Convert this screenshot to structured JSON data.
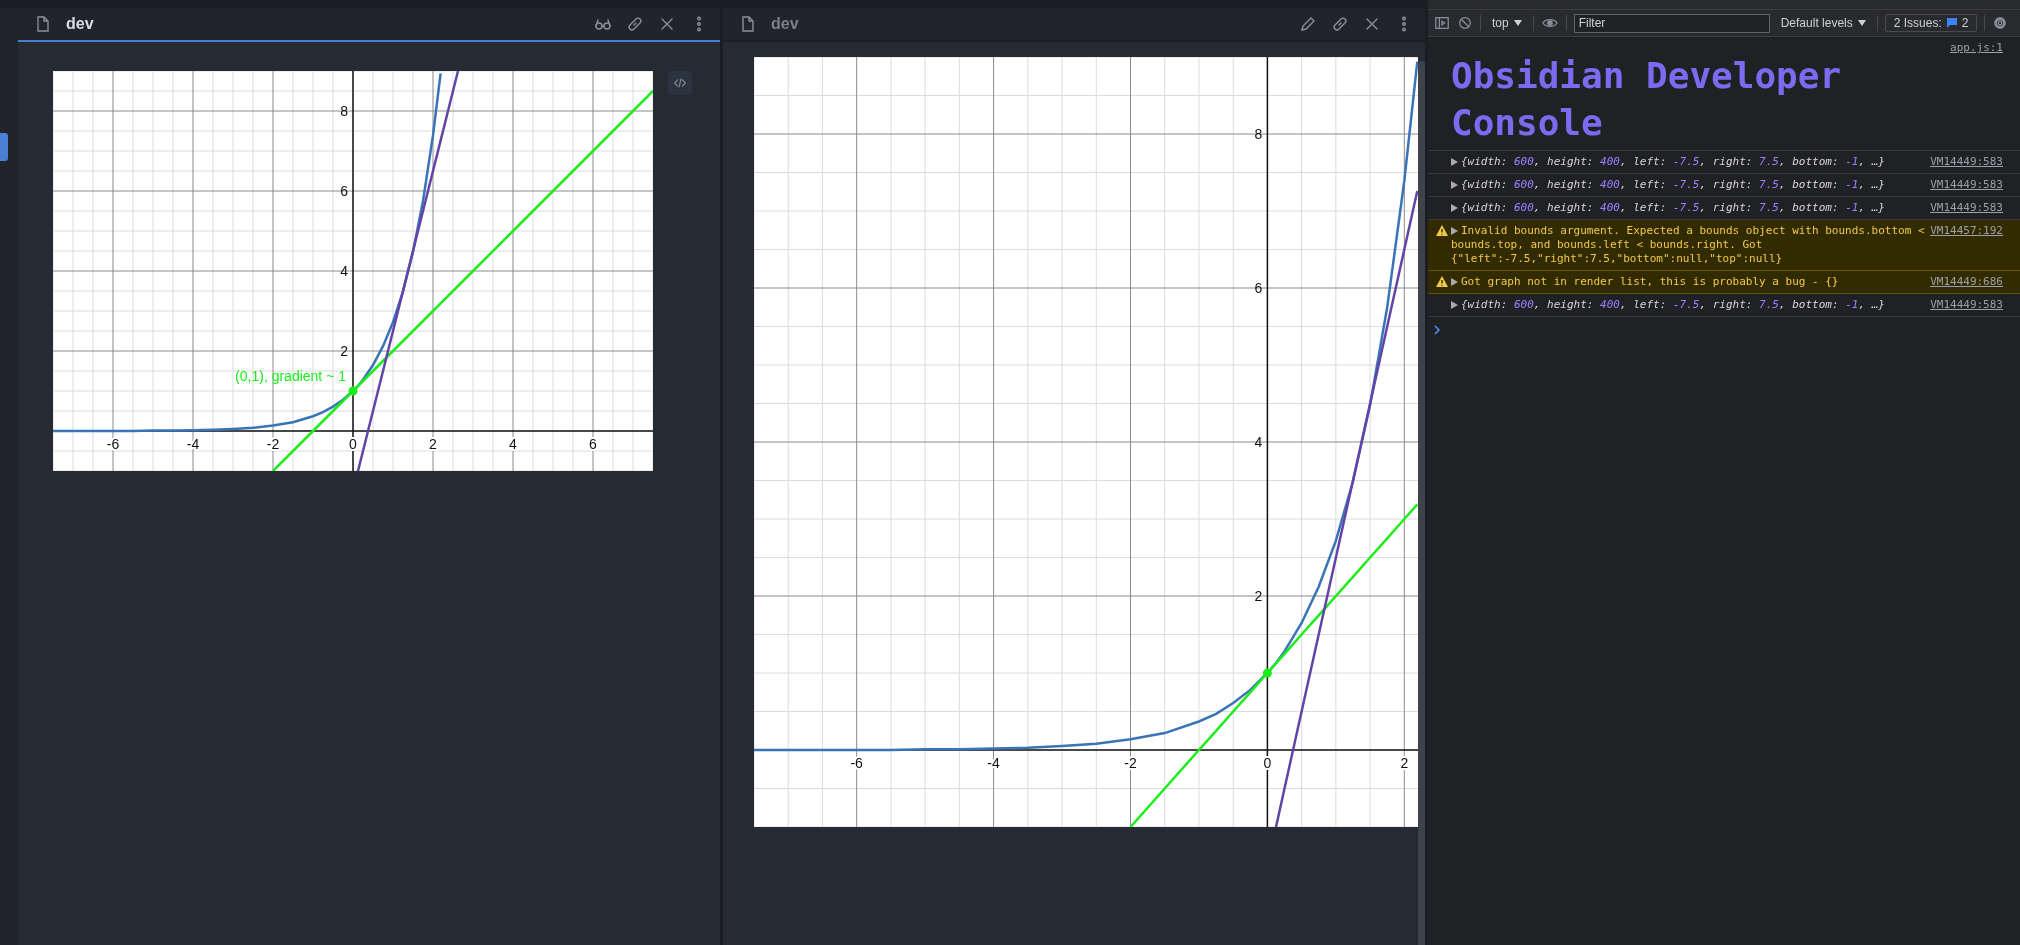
{
  "panes": [
    {
      "title": "dev",
      "active": true,
      "code_button": true,
      "actions": [
        {
          "kind": "glasses"
        },
        {
          "kind": "link"
        },
        {
          "kind": "close"
        },
        {
          "kind": "more"
        }
      ],
      "chart_data": {
        "type": "line",
        "grid": true,
        "xlim": [
          -7.5,
          7.5
        ],
        "ylim": [
          -1,
          9
        ],
        "xticks": [
          -6,
          -4,
          -2,
          0,
          2,
          4,
          6
        ],
        "yticks": [
          2,
          4,
          6,
          8
        ],
        "x": [
          -7.5,
          -7,
          -6.5,
          -6,
          -5.5,
          -5,
          -4.5,
          -4,
          -3.5,
          -3,
          -2.5,
          -2,
          -1.5,
          -1,
          -0.75,
          -0.5,
          -0.25,
          0,
          0.125,
          0.25,
          0.5,
          0.75,
          1,
          1.25,
          1.5,
          1.75,
          2,
          2.19,
          2.5,
          2.625,
          3,
          4,
          5,
          6,
          7,
          7.5
        ],
        "series": [
          {
            "color": "#3874b6",
            "values": [
              0,
              0,
              0,
              0,
              0,
              0.01,
              0.01,
              0.02,
              0.03,
              0.05,
              0.08,
              0.14,
              0.22,
              0.37,
              0.47,
              0.61,
              0.78,
              1,
              1.13,
              1.28,
              1.65,
              2.12,
              2.72,
              3.49,
              4.48,
              5.75,
              7.39,
              8.94,
              null,
              null,
              null,
              null,
              null,
              null,
              null,
              null
            ]
          },
          {
            "color": "#1aee1a",
            "values": [
              null,
              null,
              null,
              null,
              null,
              null,
              null,
              null,
              null,
              null,
              null,
              -1,
              -0.5,
              0,
              0.25,
              0.5,
              0.75,
              1,
              1.125,
              1.25,
              1.5,
              1.75,
              2,
              2.25,
              2.5,
              2.75,
              3,
              3.19,
              3.5,
              3.625,
              4,
              5,
              6,
              7,
              8,
              8.5
            ]
          },
          {
            "color": "#6443a8",
            "values": [
              null,
              null,
              null,
              null,
              null,
              null,
              null,
              null,
              null,
              null,
              null,
              null,
              null,
              null,
              null,
              null,
              null,
              null,
              -1,
              -0.5,
              0.5,
              1.5,
              2.5,
              3.5,
              4.5,
              5.5,
              6.5,
              7.26,
              8.5,
              9,
              null,
              null,
              null,
              null,
              null,
              null
            ]
          }
        ],
        "annotations": [
          {
            "x": 0,
            "y": 1,
            "text": "(0,1), gradient ~ 1"
          }
        ]
      }
    },
    {
      "title": "dev",
      "active": false,
      "actions": [
        {
          "kind": "pencil"
        },
        {
          "kind": "link"
        },
        {
          "kind": "close"
        },
        {
          "kind": "more"
        }
      ],
      "chart_data": {
        "type": "line",
        "grid": true,
        "xlim": [
          -7.5,
          2.2
        ],
        "ylim": [
          -1,
          9
        ],
        "xticks": [
          -6,
          -4,
          -2,
          0,
          2
        ],
        "yticks": [
          2,
          4,
          6,
          8
        ],
        "x": [
          -7.5,
          -7,
          -6.5,
          -6,
          -5.5,
          -5,
          -4.5,
          -4,
          -3.5,
          -3,
          -2.5,
          -2,
          -1.5,
          -1,
          -0.75,
          -0.5,
          -0.25,
          0,
          0.125,
          0.25,
          0.5,
          0.75,
          1,
          1.25,
          1.5,
          1.75,
          2,
          2.19
        ],
        "series": [
          {
            "color": "#3874b6",
            "values": [
              0,
              0,
              0,
              0,
              0,
              0.01,
              0.01,
              0.02,
              0.03,
              0.05,
              0.08,
              0.14,
              0.22,
              0.37,
              0.47,
              0.61,
              0.78,
              1,
              1.13,
              1.28,
              1.65,
              2.12,
              2.72,
              3.49,
              4.48,
              5.75,
              7.39,
              8.94
            ]
          },
          {
            "color": "#1aee1a",
            "values": [
              null,
              null,
              null,
              null,
              null,
              null,
              null,
              null,
              null,
              null,
              null,
              -1,
              -0.5,
              0,
              0.25,
              0.5,
              0.75,
              1,
              1.125,
              1.25,
              1.5,
              1.75,
              2,
              2.25,
              2.5,
              2.75,
              3,
              3.19
            ]
          },
          {
            "color": "#6443a8",
            "values": [
              null,
              null,
              null,
              null,
              null,
              null,
              null,
              null,
              null,
              null,
              null,
              null,
              null,
              null,
              null,
              null,
              null,
              null,
              -1,
              -0.5,
              0.5,
              1.5,
              2.5,
              3.5,
              4.5,
              5.5,
              6.5,
              7.26
            ]
          },
          {
            "color": "#1aee1a",
            "marker": true,
            "values": [
              null,
              null,
              null,
              null,
              null,
              null,
              null,
              null,
              null,
              null,
              null,
              null,
              null,
              null,
              null,
              null,
              null,
              1,
              null,
              null,
              null,
              null,
              null,
              null,
              null,
              null,
              null,
              null
            ]
          }
        ]
      }
    }
  ],
  "console": {
    "toolbar": {
      "context": "top",
      "filter_placeholder": "Filter",
      "levels": "Default levels",
      "issues_label": "2 Issues:",
      "issues_count": "2"
    },
    "logs": [
      {
        "kind": "heading",
        "text": "Obsidian Developer Console",
        "source": "app.js:1"
      },
      {
        "kind": "object",
        "source": "VM14449:583",
        "segments": [
          {
            "text": "{width: ",
            "kind": "key"
          },
          {
            "text": "600",
            "kind": "number"
          },
          {
            "text": ", height: ",
            "kind": "key"
          },
          {
            "text": "400",
            "kind": "number"
          },
          {
            "text": ", left: ",
            "kind": "key"
          },
          {
            "text": "-7.5",
            "kind": "number"
          },
          {
            "text": ", right: ",
            "kind": "key"
          },
          {
            "text": "7.5",
            "kind": "number"
          },
          {
            "text": ", bottom: ",
            "kind": "key"
          },
          {
            "text": "-1",
            "kind": "number"
          },
          {
            "text": ", …}",
            "kind": "key"
          }
        ]
      },
      {
        "kind": "object",
        "source": "VM14449:583",
        "segments": [
          {
            "text": "{width: ",
            "kind": "key"
          },
          {
            "text": "600",
            "kind": "number"
          },
          {
            "text": ", height: ",
            "kind": "key"
          },
          {
            "text": "400",
            "kind": "number"
          },
          {
            "text": ", left: ",
            "kind": "key"
          },
          {
            "text": "-7.5",
            "kind": "number"
          },
          {
            "text": ", right: ",
            "kind": "key"
          },
          {
            "text": "7.5",
            "kind": "number"
          },
          {
            "text": ", bottom: ",
            "kind": "key"
          },
          {
            "text": "-1",
            "kind": "number"
          },
          {
            "text": ", …}",
            "kind": "key"
          }
        ]
      },
      {
        "kind": "object",
        "source": "VM14449:583",
        "segments": [
          {
            "text": "{width: ",
            "kind": "key"
          },
          {
            "text": "600",
            "kind": "number"
          },
          {
            "text": ", height: ",
            "kind": "key"
          },
          {
            "text": "400",
            "kind": "number"
          },
          {
            "text": ", left: ",
            "kind": "key"
          },
          {
            "text": "-7.5",
            "kind": "number"
          },
          {
            "text": ", right: ",
            "kind": "key"
          },
          {
            "text": "7.5",
            "kind": "number"
          },
          {
            "text": ", bottom: ",
            "kind": "key"
          },
          {
            "text": "-1",
            "kind": "number"
          },
          {
            "text": ", …}",
            "kind": "key"
          }
        ]
      },
      {
        "kind": "warning",
        "source": "VM14457:192",
        "text": "Invalid bounds argument. Expected a bounds object with bounds.bottom < bounds.top, and bounds.left < bounds.right. Got {\"left\":-7.5,\"right\":7.5,\"bottom\":null,\"top\":null}"
      },
      {
        "kind": "warning",
        "source": "VM14449:686",
        "text": "Got graph not in render list, this is probably a bug - {}"
      },
      {
        "kind": "object",
        "source": "VM14449:583",
        "segments": [
          {
            "text": "{width: ",
            "kind": "key"
          },
          {
            "text": "600",
            "kind": "number"
          },
          {
            "text": ", height: ",
            "kind": "key"
          },
          {
            "text": "400",
            "kind": "number"
          },
          {
            "text": ", left: ",
            "kind": "key"
          },
          {
            "text": "-7.5",
            "kind": "number"
          },
          {
            "text": ", right: ",
            "kind": "key"
          },
          {
            "text": "7.5",
            "kind": "number"
          },
          {
            "text": ", bottom: ",
            "kind": "key"
          },
          {
            "text": "-1",
            "kind": "number"
          },
          {
            "text": ", …}",
            "kind": "key"
          }
        ]
      }
    ]
  }
}
